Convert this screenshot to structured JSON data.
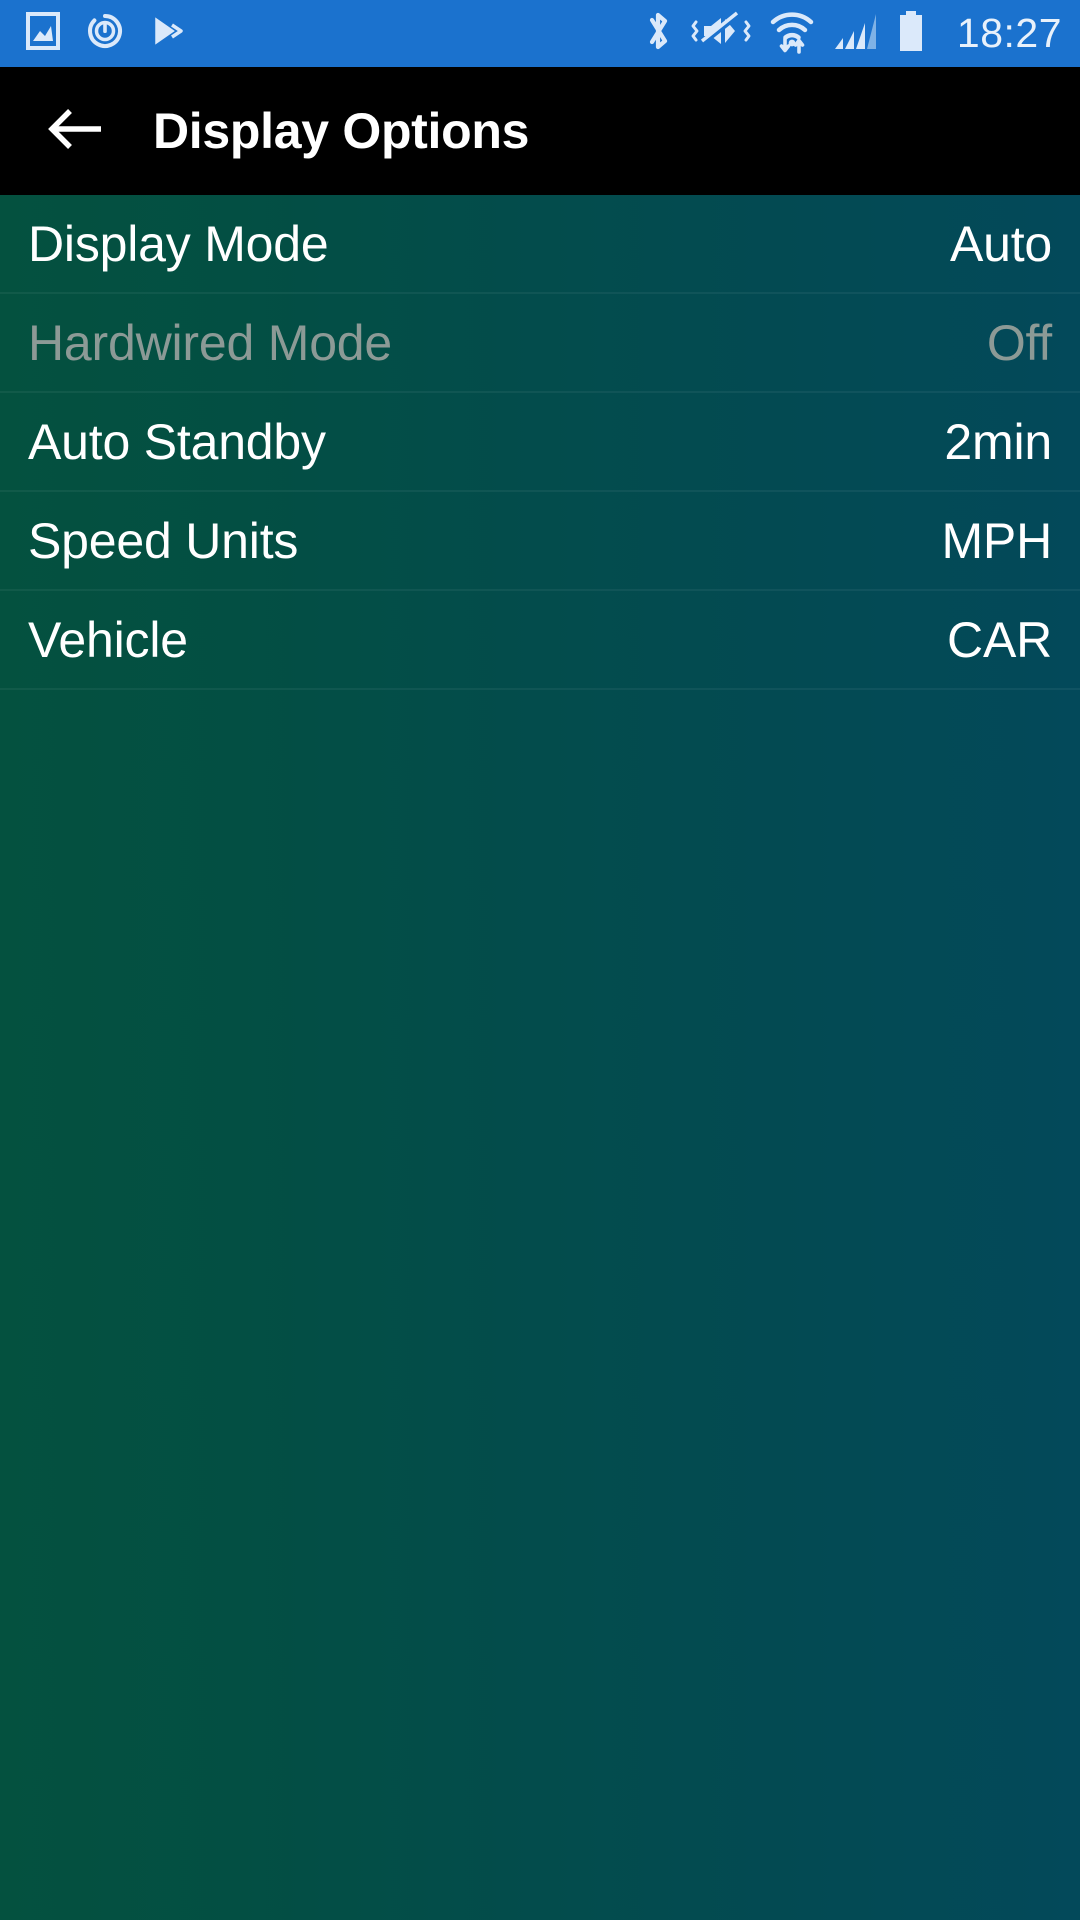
{
  "status_bar": {
    "background_color": "#1b72ce",
    "time": "18:27",
    "left_icons": [
      "image-icon",
      "power-timer-icon",
      "google-play-icon"
    ],
    "right_icons": [
      "bluetooth-icon",
      "mute-vibrate-icon",
      "wifi-data-transfer-icon",
      "cellular-signal-icon",
      "battery-icon"
    ]
  },
  "app_bar": {
    "background_color": "#000000",
    "back_icon": "back-arrow-icon",
    "title": "Display Options"
  },
  "content": {
    "background_gradient_start": "#04513f",
    "background_gradient_end": "#03495a",
    "rows": [
      {
        "label": "Display Mode",
        "value": "Auto",
        "disabled": false
      },
      {
        "label": "Hardwired Mode",
        "value": "Off",
        "disabled": true
      },
      {
        "label": "Auto Standby",
        "value": "2min",
        "disabled": false
      },
      {
        "label": "Speed Units",
        "value": "MPH",
        "disabled": false
      },
      {
        "label": "Vehicle",
        "value": "CAR",
        "disabled": false
      }
    ]
  }
}
